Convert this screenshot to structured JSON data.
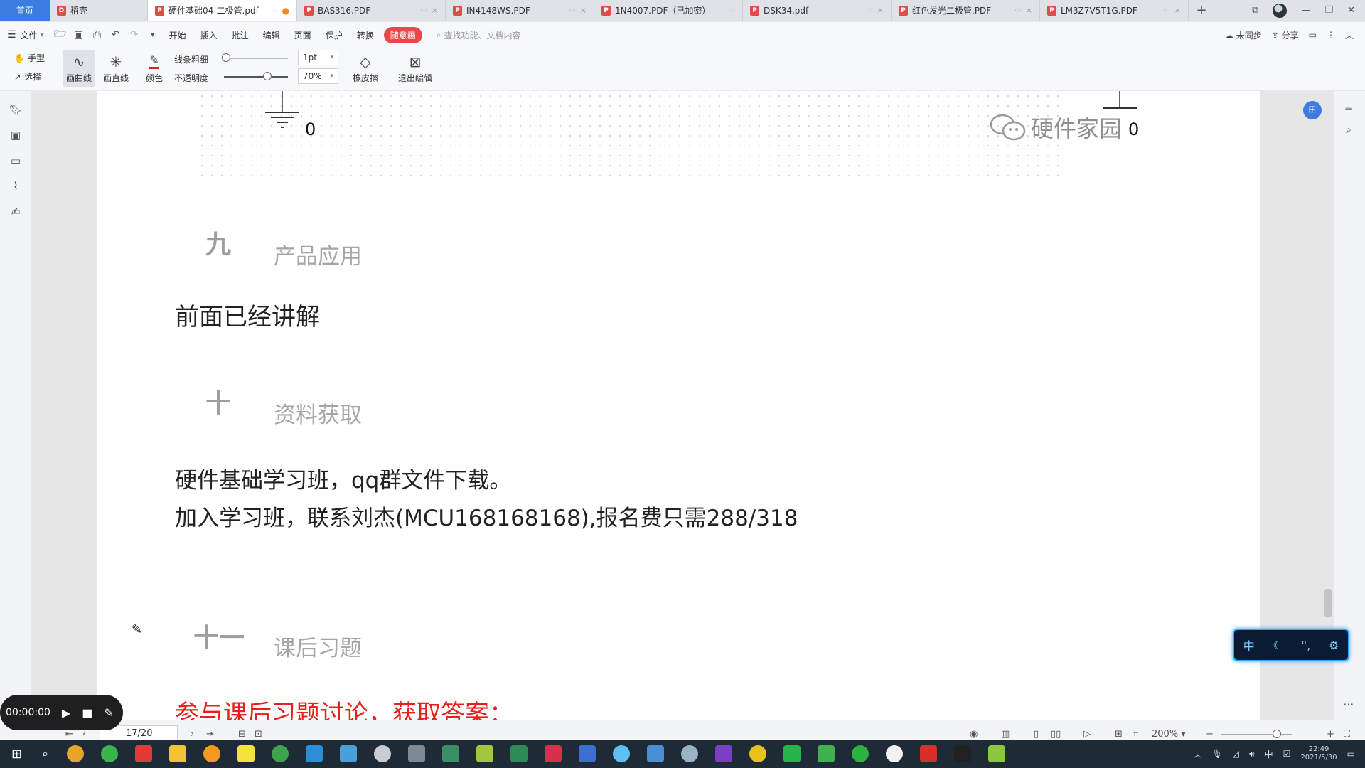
{
  "tabs": {
    "home_label": "首页",
    "items": [
      {
        "label": "稻壳"
      },
      {
        "label": "硬件基础04-二极管.pdf"
      },
      {
        "label": "BAS316.PDF"
      },
      {
        "label": "IN4148WS.PDF"
      },
      {
        "label": "1N4007.PDF（已加密）"
      },
      {
        "label": "DSK34.pdf"
      },
      {
        "label": "红色发光二极管.PDF"
      },
      {
        "label": "LM3Z7V5T1G.PDF"
      }
    ],
    "add_label": "+"
  },
  "menubar": {
    "file_label": "文件",
    "items": [
      "开始",
      "插入",
      "批注",
      "编辑",
      "页面",
      "保护",
      "转换"
    ],
    "active_pill": "随意画",
    "search_placeholder": "查找功能、文档内容",
    "sync_label": "未同步",
    "share_label": "分享"
  },
  "toolbar": {
    "hand_label": "手型",
    "select_label": "选择",
    "curve_label": "画曲线",
    "line_label": "画直线",
    "color_label": "颜色",
    "stroke_label": "线条粗细",
    "opacity_label": "不透明度",
    "stroke_value": "1pt",
    "opacity_value": "70%",
    "eraser_label": "橡皮擦",
    "exit_label": "退出编辑"
  },
  "document": {
    "ground_left_label": "0",
    "ground_right_label": "0",
    "watermark_text": "硬件家园",
    "sections": [
      {
        "number": "九",
        "title": "产品应用"
      },
      {
        "number": "十",
        "title": "资料获取"
      },
      {
        "number": "十一",
        "title": "课后习题"
      }
    ],
    "body_lines": [
      "前面已经讲解",
      "硬件基础学习班，qq群文件下载。",
      "加入学习班，联系刘杰(MCU168168168),报名费只需288/318"
    ],
    "red_line": "参与课后习题讨论，获取答案："
  },
  "statusbar": {
    "page_indicator": "17/20",
    "zoom_value": "200%"
  },
  "recorder": {
    "time": "00:00:00"
  },
  "ime": {
    "lang": "中"
  },
  "taskbar": {
    "tray_lang": "中",
    "clock_time": "22:49",
    "clock_date": "2021/5/30"
  },
  "colors": {
    "accent_blue": "#3c7be0",
    "pill_red": "#e9474a",
    "red_text": "#e8201c",
    "section_gray": "#a5a5a5"
  }
}
